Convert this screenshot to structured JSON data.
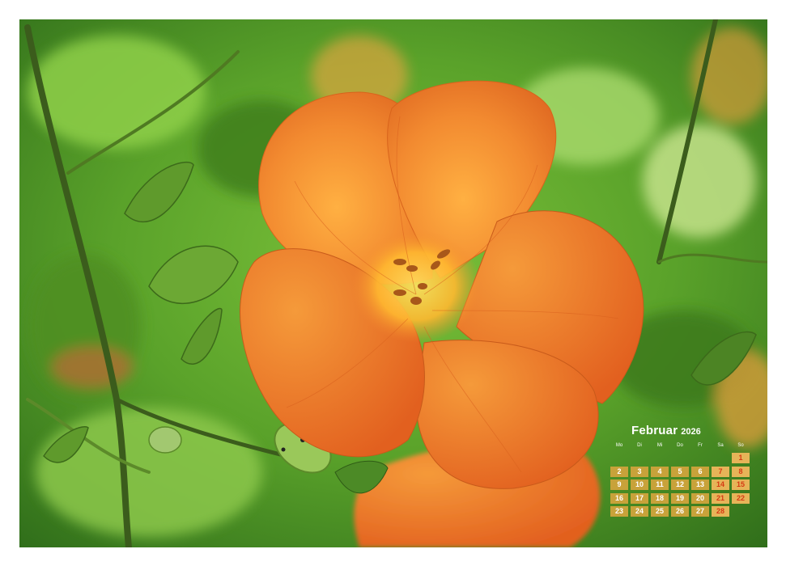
{
  "calendar": {
    "month": "Februar",
    "year": "2026",
    "weekdays": [
      "Mo",
      "Di",
      "Mi",
      "Do",
      "Fr",
      "Sa",
      "So"
    ],
    "weeks": [
      [
        "",
        "",
        "",
        "",
        "",
        "",
        "1"
      ],
      [
        "2",
        "3",
        "4",
        "5",
        "6",
        "7",
        "8"
      ],
      [
        "9",
        "10",
        "11",
        "12",
        "13",
        "14",
        "15"
      ],
      [
        "16",
        "17",
        "18",
        "19",
        "20",
        "21",
        "22"
      ],
      [
        "23",
        "24",
        "25",
        "26",
        "27",
        "28",
        ""
      ]
    ]
  },
  "colors": {
    "foliage": "#5a9b2a",
    "petal": "#f07a2a",
    "calendar_cell": "#c8a23a",
    "weekend_text": "#d63a14"
  }
}
